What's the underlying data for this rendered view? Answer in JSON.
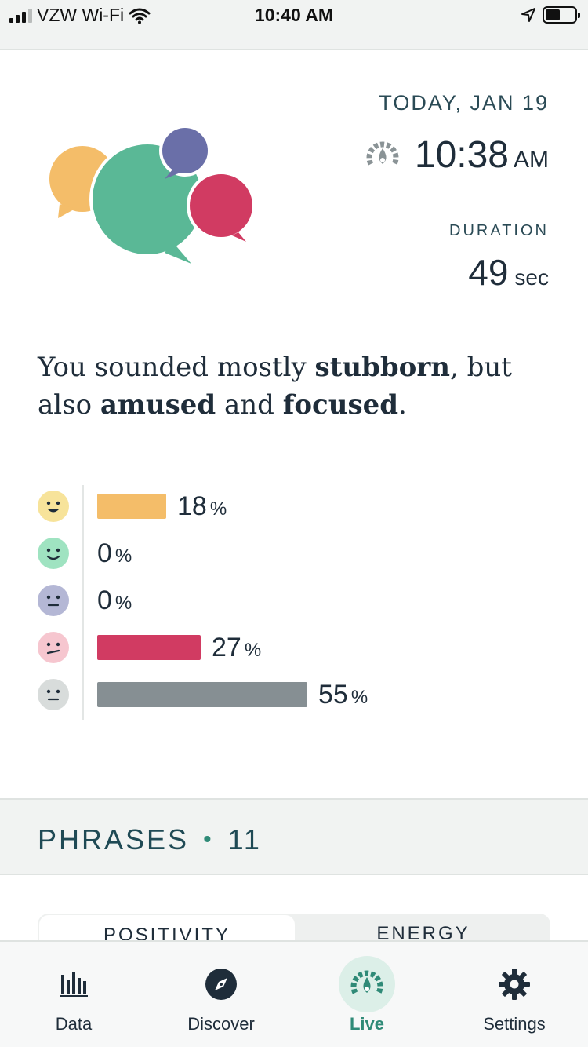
{
  "status_bar": {
    "carrier": "VZW Wi-Fi",
    "time": "10:40 AM"
  },
  "session": {
    "date": "TODAY, JAN 19",
    "start_time": "10:38",
    "start_ampm": "AM",
    "duration_label": "DURATION",
    "duration_value": "49",
    "duration_unit": "sec"
  },
  "summary": {
    "prefix": "You sounded mostly ",
    "primary": "stubborn",
    "middle1": ", but also ",
    "secondary1": "amused",
    "middle2": " and ",
    "secondary2": "focused",
    "suffix": "."
  },
  "emotions": [
    {
      "face": "amused-face-icon",
      "percent": "18",
      "value": 18,
      "color": "#f4bd69",
      "face_bg": "#f7e39a"
    },
    {
      "face": "happy-face-icon",
      "percent": "0",
      "value": 0,
      "color": "#5fcf9e",
      "face_bg": "#9fe3c1"
    },
    {
      "face": "sad-face-icon",
      "percent": "0",
      "value": 0,
      "color": "#6a6fa8",
      "face_bg": "#b4b7d5"
    },
    {
      "face": "stubborn-face-icon",
      "percent": "27",
      "value": 27,
      "color": "#d13b62",
      "face_bg": "#f6c6cf"
    },
    {
      "face": "neutral-face-icon",
      "percent": "55",
      "value": 55,
      "color": "#868f93",
      "face_bg": "#d8dcdb"
    }
  ],
  "percent_symbol": "%",
  "phrases": {
    "label": "PHRASES",
    "separator": "•",
    "count": "11"
  },
  "tabs": {
    "positivity": "POSITIVITY",
    "energy": "ENERGY"
  },
  "nav": {
    "data": "Data",
    "discover": "Discover",
    "live": "Live",
    "settings": "Settings"
  },
  "colors": {
    "accent": "#2f8a77",
    "text": "#1f2d3a",
    "heading": "#2a4a55"
  }
}
